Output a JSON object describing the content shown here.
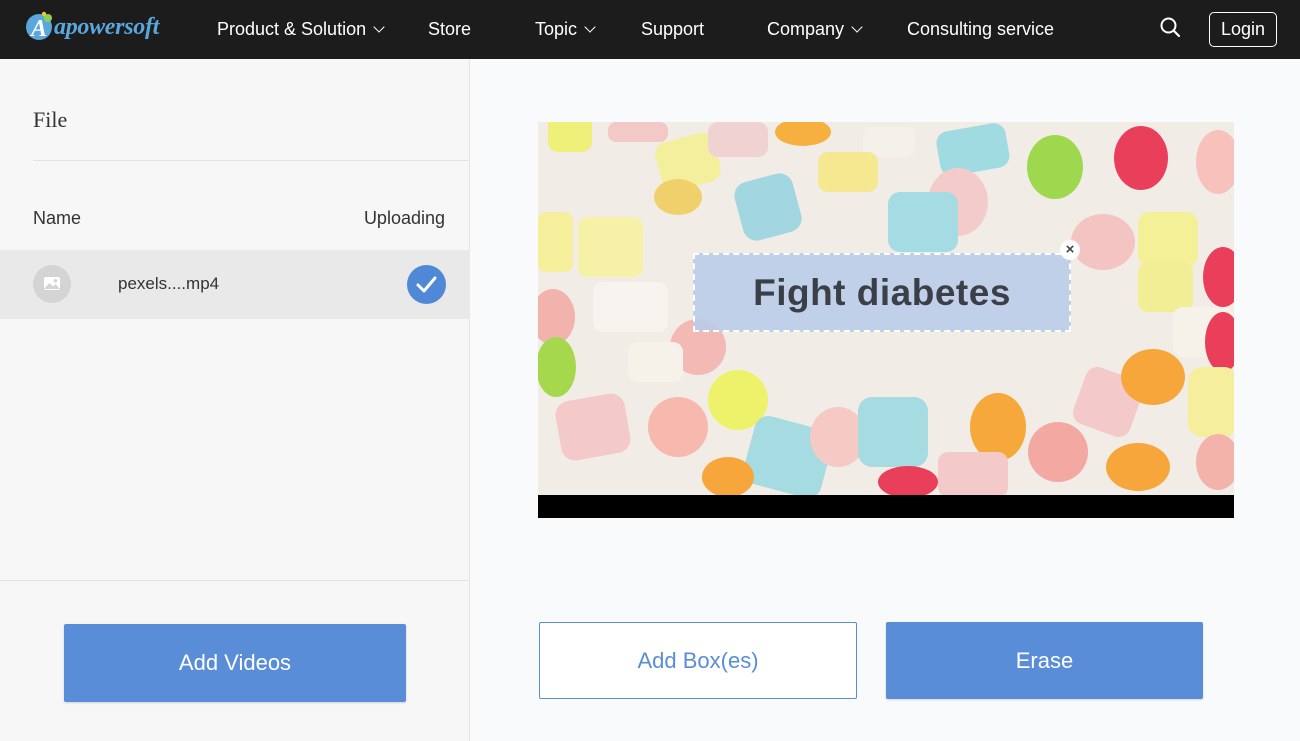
{
  "brand": {
    "name": "apowersoft",
    "accent": "#5a8dd8",
    "logo_color": "#5aa7de"
  },
  "nav": {
    "items": [
      {
        "label": "Product & Solution",
        "has_dropdown": true
      },
      {
        "label": "Store",
        "has_dropdown": false
      },
      {
        "label": "Topic",
        "has_dropdown": true
      },
      {
        "label": "Support",
        "has_dropdown": false
      },
      {
        "label": "Company",
        "has_dropdown": true
      },
      {
        "label": "Consulting service",
        "has_dropdown": false
      }
    ],
    "search_icon": "search-icon",
    "login_label": "Login"
  },
  "file_panel": {
    "title": "File",
    "columns": {
      "name": "Name",
      "status": "Uploading"
    },
    "files": [
      {
        "name": "pexels....mp4",
        "thumbnail_icon": "image-icon",
        "status_icon": "check-circle-icon",
        "uploaded": true
      }
    ],
    "add_videos_label": "Add Videos"
  },
  "preview": {
    "selection_text": "Fight diabetes",
    "close_glyph": "×"
  },
  "actions": {
    "add_boxes_label": "Add Box(es)",
    "erase_label": "Erase"
  }
}
